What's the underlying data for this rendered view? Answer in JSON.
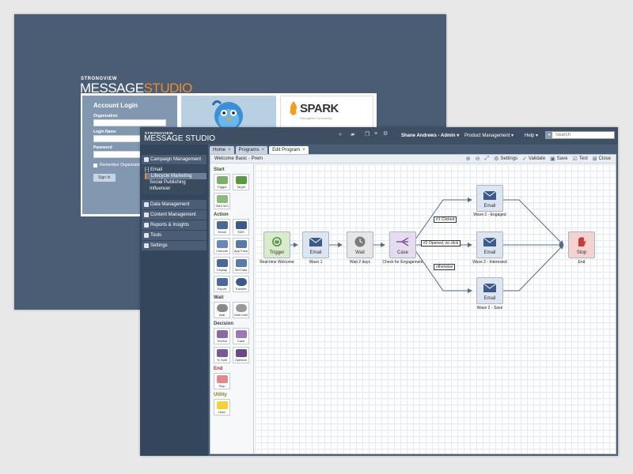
{
  "login_screen": {
    "brand_top": "STRONGVIEW",
    "brand_main_a": "MESSAGE",
    "brand_main_b": "STUDIO",
    "title": "Account Login",
    "organization_label": "Organization",
    "login_name_label": "Login Name",
    "password_label": "Password",
    "remember_label": "Remember Organization",
    "sign_in_label": "Sign In",
    "spark_label": "SPARK",
    "spark_sub": "StrongMail Community"
  },
  "app": {
    "brand_top": "STRONGVIEW",
    "brand_main": "MESSAGE STUDIO",
    "user": "Shane Andrews - Admin",
    "menu_product": "Product Management",
    "menu_help": "Help",
    "search_placeholder": "Search",
    "colors": {
      "accent": "#f08a2e",
      "nav_bg": "#34465b",
      "frame": "#4a5d75"
    }
  },
  "sidebar": {
    "campaign": "Campaign Management",
    "email_header": "[-] Email",
    "email_items": [
      "Lifecycle Marketing",
      "Social Publishing",
      "Influencer"
    ],
    "data": "Data Management",
    "content": "Content Management",
    "reports": "Reports & Insights",
    "tools": "Tools",
    "settings": "Settings"
  },
  "tabs": [
    {
      "label": "Home",
      "close": "×"
    },
    {
      "label": "Programs",
      "close": "×"
    },
    {
      "label": "Edit Program",
      "close": "×"
    }
  ],
  "toolbar": {
    "program_name": "Welcome Basic - Prem",
    "settings": "Settings",
    "validate": "Validate",
    "save": "Save",
    "test": "Test",
    "close": "Close"
  },
  "palette": {
    "start_title": "Start",
    "start_items": [
      "Trigger",
      "Target",
      "SMS MO"
    ],
    "action_title": "Action",
    "action_items": [
      "Email",
      "SMS",
      "Channel",
      "App Push",
      "Display",
      "Set Data",
      "Export",
      "Transfer"
    ],
    "wait_title": "Wait",
    "wait_items": [
      "Wait",
      "Wait Until"
    ],
    "decision_title": "Decision",
    "decision_items": [
      "Yes/No",
      "Case",
      "% Split",
      "Optimize"
    ],
    "end_title": "End",
    "end_items": [
      "Stop"
    ],
    "utility_title": "Utility",
    "utility_items": [
      "Note"
    ]
  },
  "flow": {
    "trigger": {
      "label": "Trigger",
      "caption": "Real-time Welcome"
    },
    "email1": {
      "label": "Email",
      "caption": "Wave 1"
    },
    "wait": {
      "label": "Wait",
      "caption": "Wait 2 days"
    },
    "case": {
      "label": "Case",
      "caption": "Check for Engagement"
    },
    "email_engaged": {
      "label": "Email",
      "caption": "Wave 2 - Engaged"
    },
    "email_interested": {
      "label": "Email",
      "caption": "Wave 2 - Interested"
    },
    "email_save": {
      "label": "Email",
      "caption": "Wave 2 - Save"
    },
    "stop": {
      "label": "Stop",
      "caption": "End"
    },
    "branch1": "#1 Clicked",
    "branch2": "#2 Opened, no click",
    "branch3": "otherwise"
  }
}
